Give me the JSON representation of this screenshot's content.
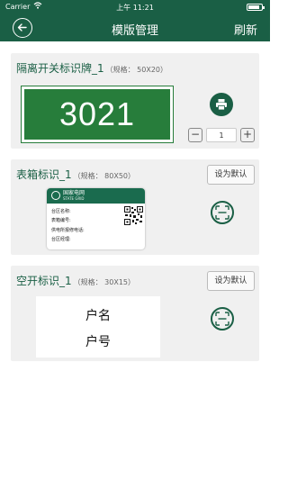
{
  "status_bar": {
    "carrier": "Carrier",
    "time": "上午 11:21"
  },
  "nav": {
    "title": "模版管理",
    "refresh": "刷新"
  },
  "templates": [
    {
      "name": "隔离开关标识牌_1",
      "spec": "（规格：  50X20）",
      "plate_number": "3021",
      "quantity": "1",
      "minus": "−",
      "plus": "+"
    },
    {
      "name": "表箱标识_1",
      "spec": "（规格：  80X50）",
      "default_button": "设为默认",
      "label": {
        "brand": "国家电网",
        "brand_en": "STATE GRID",
        "rows": [
          "台区名称:",
          "表箱编号:",
          "供电所报修电话:",
          "台区经理:"
        ]
      }
    },
    {
      "name": "空开标识_1",
      "spec": "（规格：  30X15）",
      "default_button": "设为默认",
      "lines": [
        "户名",
        "户号"
      ]
    }
  ],
  "colors": {
    "primary": "#1a5f45",
    "plate_green": "#277d3b",
    "card_bg": "#f0f0f0"
  },
  "icons": {
    "back": "back-arrow-icon",
    "print": "printer-icon",
    "scan": "scan-icon"
  }
}
